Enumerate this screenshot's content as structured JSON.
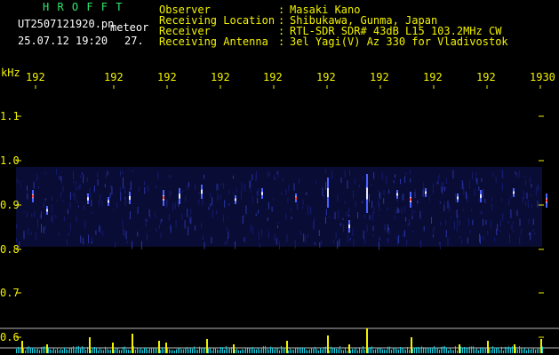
{
  "header": {
    "app_name": "H R O F F T",
    "file_name": "UT2507121920.pn",
    "mode_label": "meteor",
    "datetime": "25.07.12 19:20",
    "count_value": "27.",
    "info": [
      {
        "label": "Observer",
        "sep": ":",
        "value": "Masaki Kano"
      },
      {
        "label": "Receiving Location",
        "sep": ":",
        "value": "Shibukawa, Gunma, Japan"
      },
      {
        "label": "Receiver",
        "sep": ":",
        "value": "RTL-SDR SDR# 43dB L15 103.2MHz CW"
      },
      {
        "label": "Receiving Antenna",
        "sep": ":",
        "value": "3el Yagi(V) Az 330 for Vladivostok"
      }
    ]
  },
  "axis": {
    "unit": "kHz",
    "x_labels": [
      "192",
      "192",
      "192",
      "192",
      "192",
      "192",
      "192",
      "192",
      "192",
      "1930"
    ],
    "y_labels": [
      "1.1",
      "1.0",
      "0.9",
      "0.8",
      "0.7",
      "0.6"
    ]
  },
  "colors": {
    "label": "#f2f200",
    "title": "#2ee86a",
    "background": "#000000",
    "band": "#141a6e",
    "reference_line": "#b8b8b8",
    "peak": "#ff3030"
  }
}
